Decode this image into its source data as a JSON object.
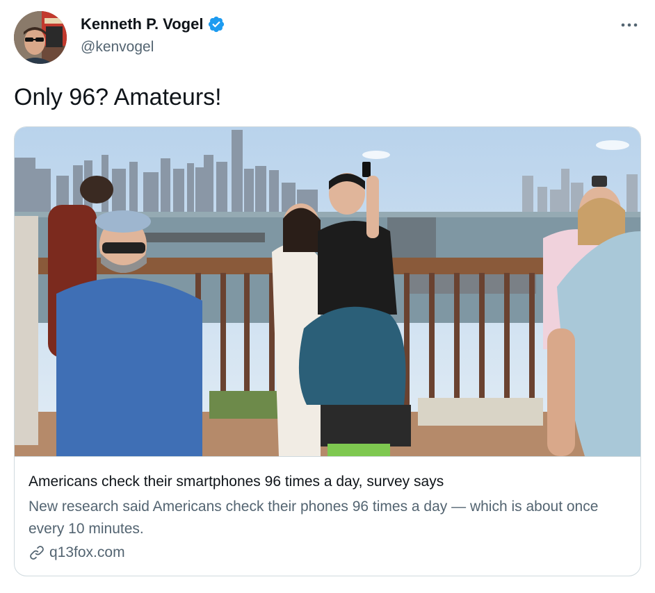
{
  "author": {
    "display_name": "Kenneth P. Vogel",
    "handle": "@kenvogel",
    "verified": true,
    "avatar_icon": "profile-photo"
  },
  "tweet": {
    "text": "Only 96? Amateurs!"
  },
  "card": {
    "image_description": "People taking selfies on a boardwalk overlooking a city skyline and river",
    "title": "Americans check their smartphones 96 times a day, survey says",
    "description": "New research said Americans check their phones 96 times a day — which is about once every 10 minutes.",
    "domain": "q13fox.com"
  },
  "icons": {
    "more": "more-horizontal-icon",
    "verified": "verified-badge-icon",
    "link": "link-icon"
  },
  "colors": {
    "text_primary": "#0f1419",
    "text_secondary": "#536471",
    "verified_blue": "#1d9bf0",
    "border": "#cfd9de"
  }
}
